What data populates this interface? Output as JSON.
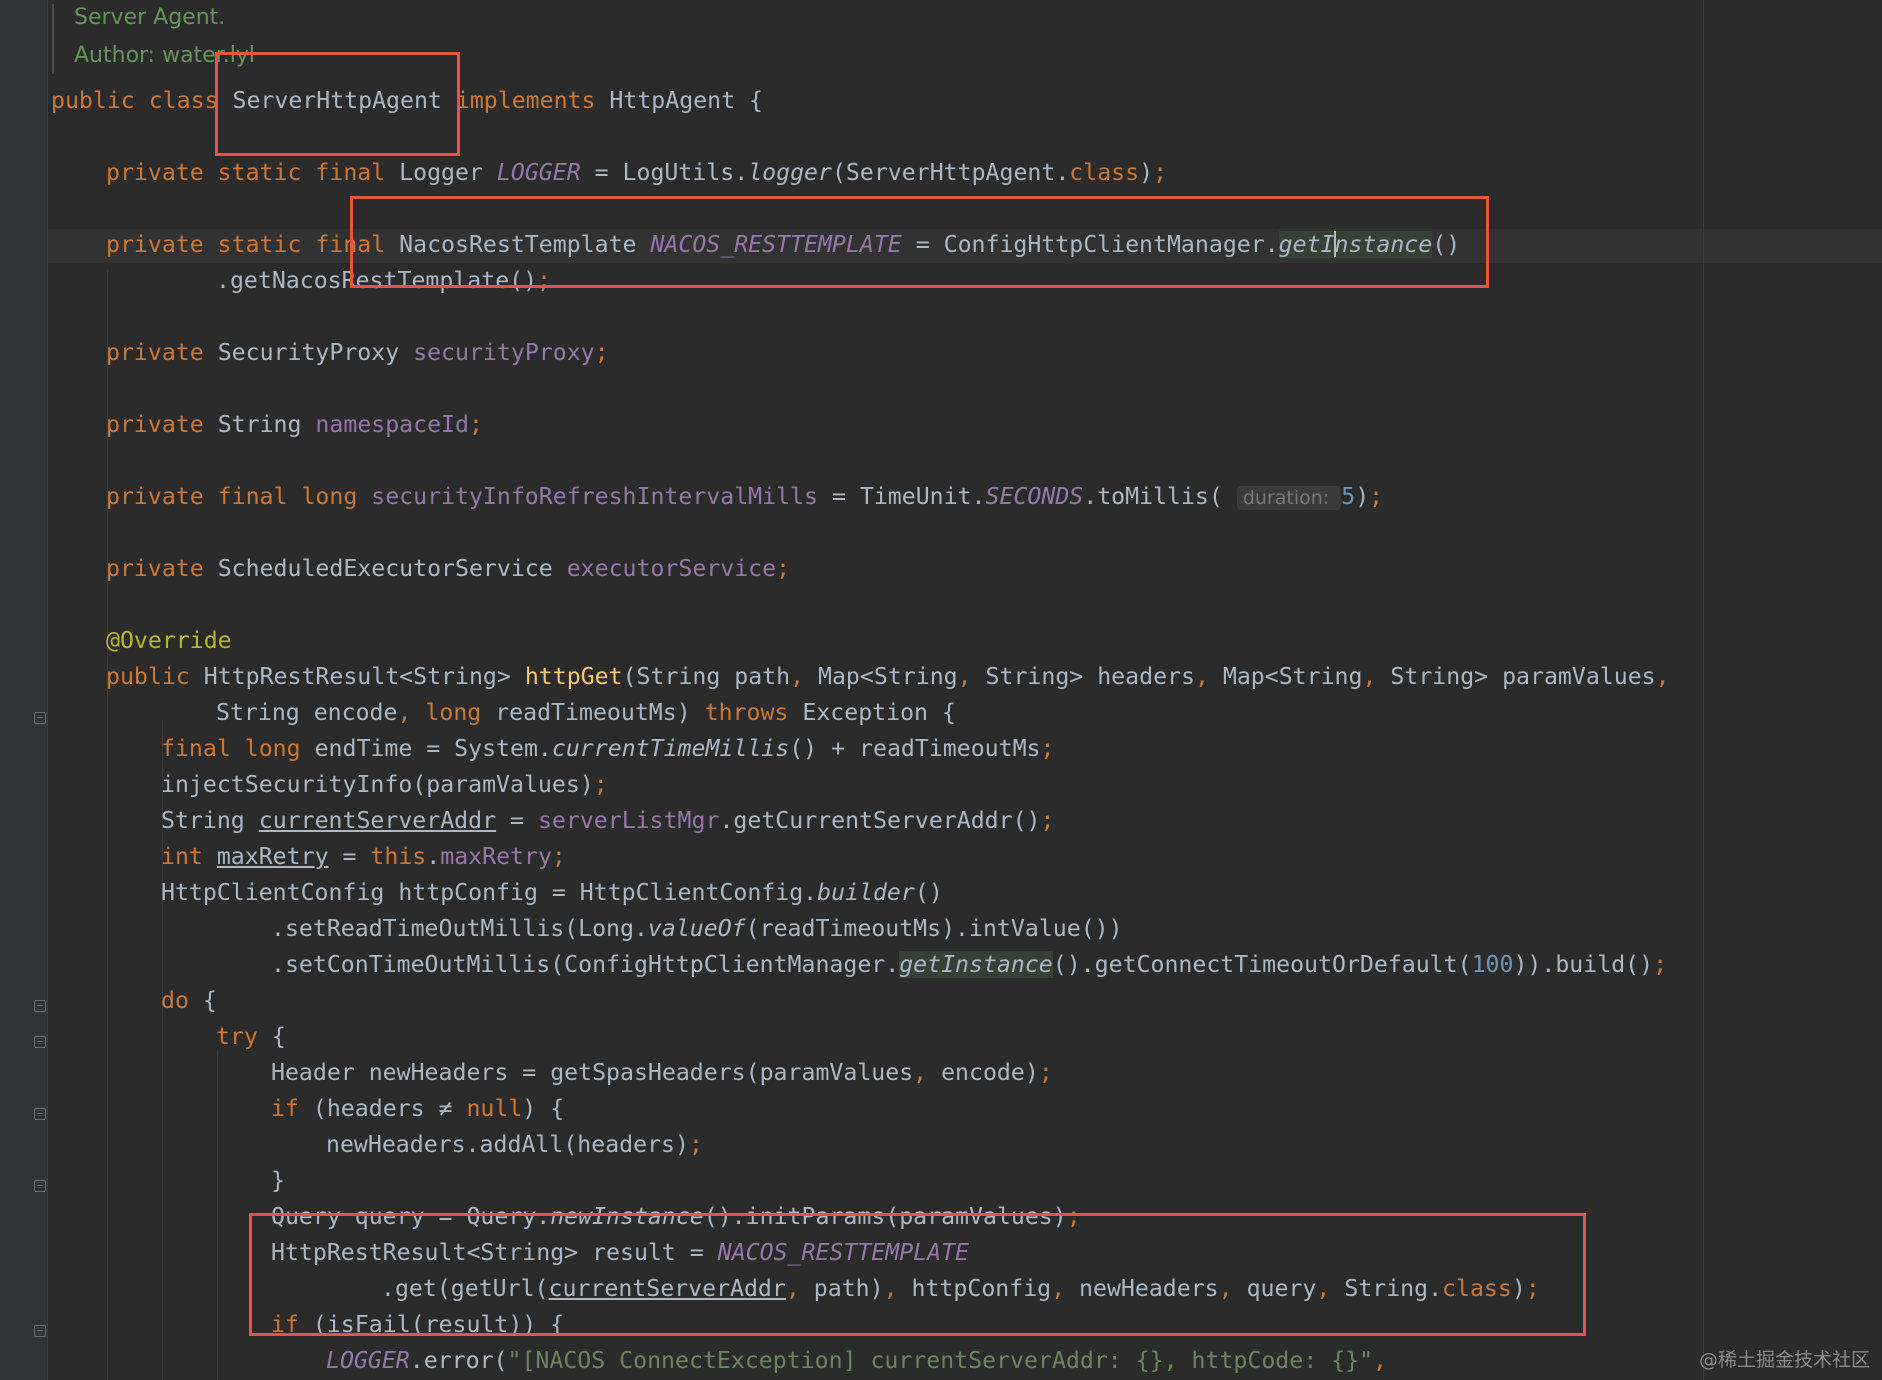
{
  "doc_comment": {
    "line1": "Server Agent.",
    "line2": "Author: water.lyl"
  },
  "code": [
    [
      [
        "kw",
        "public class "
      ],
      [
        "",
        "ServerHttpAgent "
      ],
      [
        "kw",
        "implements "
      ],
      [
        "",
        "HttpAgent {"
      ]
    ],
    [
      [
        "kw",
        "private static final "
      ],
      [
        "",
        "Logger "
      ],
      [
        "cst",
        "LOGGER"
      ],
      [
        "",
        " = LogUtils."
      ],
      [
        "it",
        "logger"
      ],
      [
        "",
        "(ServerHttpAgent."
      ],
      [
        "kw",
        "class"
      ],
      [
        "",
        ")"
      ],
      [
        "kw",
        ";"
      ]
    ],
    [
      [
        "kw",
        "private static final "
      ],
      [
        "",
        "NacosRestTemplate "
      ],
      [
        "cst",
        "NACOS_RESTTEMPLATE"
      ],
      [
        "",
        " = ConfigHttpClientManager."
      ],
      [
        "usage",
        "getInstance"
      ],
      [
        "",
        "()"
      ]
    ],
    [
      [
        "",
        ".getNacosRestTemplate()"
      ],
      [
        "kw",
        ";"
      ]
    ],
    [
      [
        "kw",
        "private "
      ],
      [
        "",
        "SecurityProxy "
      ],
      [
        "fld",
        "securityProxy"
      ],
      [
        "kw",
        ";"
      ]
    ],
    [
      [
        "kw",
        "private "
      ],
      [
        "",
        "String "
      ],
      [
        "fld",
        "namespaceId"
      ],
      [
        "kw",
        ";"
      ]
    ],
    [
      [
        "kw",
        "private final long "
      ],
      [
        "fld",
        "securityInfoRefreshIntervalMills"
      ],
      [
        "",
        " = TimeUnit."
      ],
      [
        "cst",
        "SECONDS"
      ],
      [
        "",
        ".toMillis( "
      ],
      [
        "hint",
        "duration: "
      ],
      [
        "num",
        "5"
      ],
      [
        "",
        ")"
      ],
      [
        "kw",
        ";"
      ]
    ],
    [
      [
        "kw",
        "private "
      ],
      [
        "",
        "ScheduledExecutorService "
      ],
      [
        "fld",
        "executorService"
      ],
      [
        "kw",
        ";"
      ]
    ],
    [
      [
        "ann",
        "@Override"
      ]
    ],
    [
      [
        "kw",
        "public "
      ],
      [
        "",
        "HttpRestResult<String> "
      ],
      [
        "fn",
        "httpGet"
      ],
      [
        "",
        "(String path"
      ],
      [
        "kw",
        ", "
      ],
      [
        "",
        "Map<String"
      ],
      [
        "kw",
        ", "
      ],
      [
        "",
        "String> headers"
      ],
      [
        "kw",
        ", "
      ],
      [
        "",
        "Map<String"
      ],
      [
        "kw",
        ", "
      ],
      [
        "",
        "String> paramValues"
      ],
      [
        "kw",
        ","
      ]
    ],
    [
      [
        "",
        "String encode"
      ],
      [
        "kw",
        ", long "
      ],
      [
        "",
        "readTimeoutMs) "
      ],
      [
        "kw",
        "throws "
      ],
      [
        "",
        "Exception {"
      ]
    ],
    [
      [
        "kw",
        "final long "
      ],
      [
        "",
        "endTime = System."
      ],
      [
        "it",
        "currentTimeMillis"
      ],
      [
        "",
        "() + readTimeoutMs"
      ],
      [
        "kw",
        ";"
      ]
    ],
    [
      [
        "",
        "injectSecurityInfo(paramValues)"
      ],
      [
        "kw",
        ";"
      ]
    ],
    [
      [
        "",
        "String "
      ],
      [
        "ul",
        "currentServerAddr"
      ],
      [
        "",
        " = "
      ],
      [
        "fld",
        "serverListMgr"
      ],
      [
        "",
        ".getCurrentServerAddr()"
      ],
      [
        "kw",
        ";"
      ]
    ],
    [
      [
        "kw",
        "int "
      ],
      [
        "ul",
        "maxRetry"
      ],
      [
        "",
        " = "
      ],
      [
        "kw",
        "this"
      ],
      [
        "",
        "."
      ],
      [
        "fld",
        "maxRetry"
      ],
      [
        "kw",
        ";"
      ]
    ],
    [
      [
        "",
        "HttpClientConfig httpConfig = HttpClientConfig."
      ],
      [
        "it",
        "builder"
      ],
      [
        "",
        "()"
      ]
    ],
    [
      [
        "",
        ".setReadTimeOutMillis(Long."
      ],
      [
        "it",
        "valueOf"
      ],
      [
        "",
        "(readTimeoutMs).intValue())"
      ]
    ],
    [
      [
        "",
        ".setConTimeOutMillis(ConfigHttpClientManager."
      ],
      [
        "usage",
        "getInstance"
      ],
      [
        "",
        "().getConnectTimeoutOrDefault("
      ],
      [
        "num",
        "100"
      ],
      [
        "",
        ")).build()"
      ],
      [
        "kw",
        ";"
      ]
    ],
    [
      [
        "kw",
        "do "
      ],
      [
        "",
        "{"
      ]
    ],
    [
      [
        "kw",
        "try "
      ],
      [
        "",
        "{"
      ]
    ],
    [
      [
        "",
        "Header newHeaders = getSpasHeaders(paramValues"
      ],
      [
        "kw",
        ", "
      ],
      [
        "",
        "encode)"
      ],
      [
        "kw",
        ";"
      ]
    ],
    [
      [
        "kw",
        "if "
      ],
      [
        "",
        "(headers ≠ "
      ],
      [
        "kw",
        "null"
      ],
      [
        "",
        ") {"
      ]
    ],
    [
      [
        "",
        "newHeaders.addAll(headers)"
      ],
      [
        "kw",
        ";"
      ]
    ],
    [
      [
        "",
        "}"
      ]
    ],
    [
      [
        "",
        "Query query = Query."
      ],
      [
        "it",
        "newInstance"
      ],
      [
        "",
        "().initParams(paramValues)"
      ],
      [
        "kw",
        ";"
      ]
    ],
    [
      [
        "",
        "HttpRestResult<String> result = "
      ],
      [
        "cst",
        "NACOS_RESTTEMPLATE"
      ]
    ],
    [
      [
        "",
        ".get(getUrl("
      ],
      [
        "ul",
        "currentServerAddr"
      ],
      [
        "kw",
        ", "
      ],
      [
        "",
        "path)"
      ],
      [
        "kw",
        ", "
      ],
      [
        "",
        "httpConfig"
      ],
      [
        "kw",
        ", "
      ],
      [
        "",
        "newHeaders"
      ],
      [
        "kw",
        ", "
      ],
      [
        "",
        "query"
      ],
      [
        "kw",
        ", "
      ],
      [
        "",
        "String."
      ],
      [
        "kw",
        "class"
      ],
      [
        "",
        ")"
      ],
      [
        "kw",
        ";"
      ]
    ],
    [
      [
        "kw",
        "if "
      ],
      [
        "",
        "(isFail(result)) {"
      ]
    ],
    [
      [
        "cst",
        "LOGGER"
      ],
      [
        "",
        ".error("
      ],
      [
        "str",
        "\"[NACOS ConnectException] currentServerAddr: {}, httpCode: {}\""
      ],
      [
        "kw",
        ","
      ]
    ]
  ],
  "watermark": "@稀土掘金技术社区",
  "colors": {
    "background": "#2b2b2b",
    "keyword": "#cc7832",
    "field": "#9876aa",
    "method_decl": "#ffc66d",
    "annotation": "#bbb529",
    "number": "#6897bb",
    "string": "#6a8759",
    "doc_comment": "#629755",
    "highlight_box": "#e8553a"
  }
}
